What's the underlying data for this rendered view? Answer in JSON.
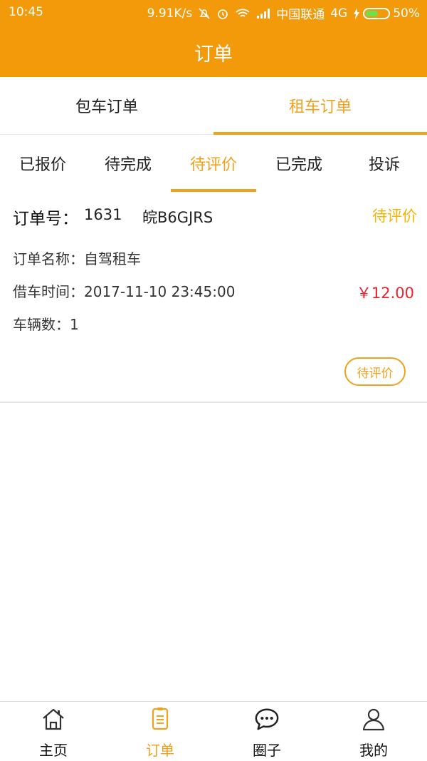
{
  "status_bar": {
    "time": "10:45",
    "speed": "9.91K/s",
    "carrier": "中国联通",
    "network": "4G",
    "battery": "50%"
  },
  "header": {
    "title": "订单"
  },
  "tabs": [
    {
      "label": "包车订单",
      "active": false
    },
    {
      "label": "租车订单",
      "active": true
    }
  ],
  "subtabs": [
    {
      "label": "已报价",
      "active": false
    },
    {
      "label": "待完成",
      "active": false
    },
    {
      "label": "待评价",
      "active": true
    },
    {
      "label": "已完成",
      "active": false
    },
    {
      "label": "投诉",
      "active": false
    }
  ],
  "order": {
    "number_label": "订单号：",
    "number": "1631",
    "plate": "皖B6GJRS",
    "status": "待评价",
    "name_label": "订单名称：",
    "name": "自驾租车",
    "time_label": "借车时间：",
    "time": "2017-11-10 23:45:00",
    "price": "￥12.00",
    "vehicles_label": "车辆数：",
    "vehicles": "1",
    "action_label": "待评价"
  },
  "bottom_nav": [
    {
      "label": "主页",
      "icon": "home-icon",
      "active": false
    },
    {
      "label": "订单",
      "icon": "clipboard-icon",
      "active": true
    },
    {
      "label": "圈子",
      "icon": "chat-bubble-icon",
      "active": false
    },
    {
      "label": "我的",
      "icon": "user-icon",
      "active": false
    }
  ],
  "colors": {
    "header": "#F39A0B",
    "accent": "#F0A11E",
    "status_yellow": "#F5B400",
    "price_red": "#E8242D"
  }
}
